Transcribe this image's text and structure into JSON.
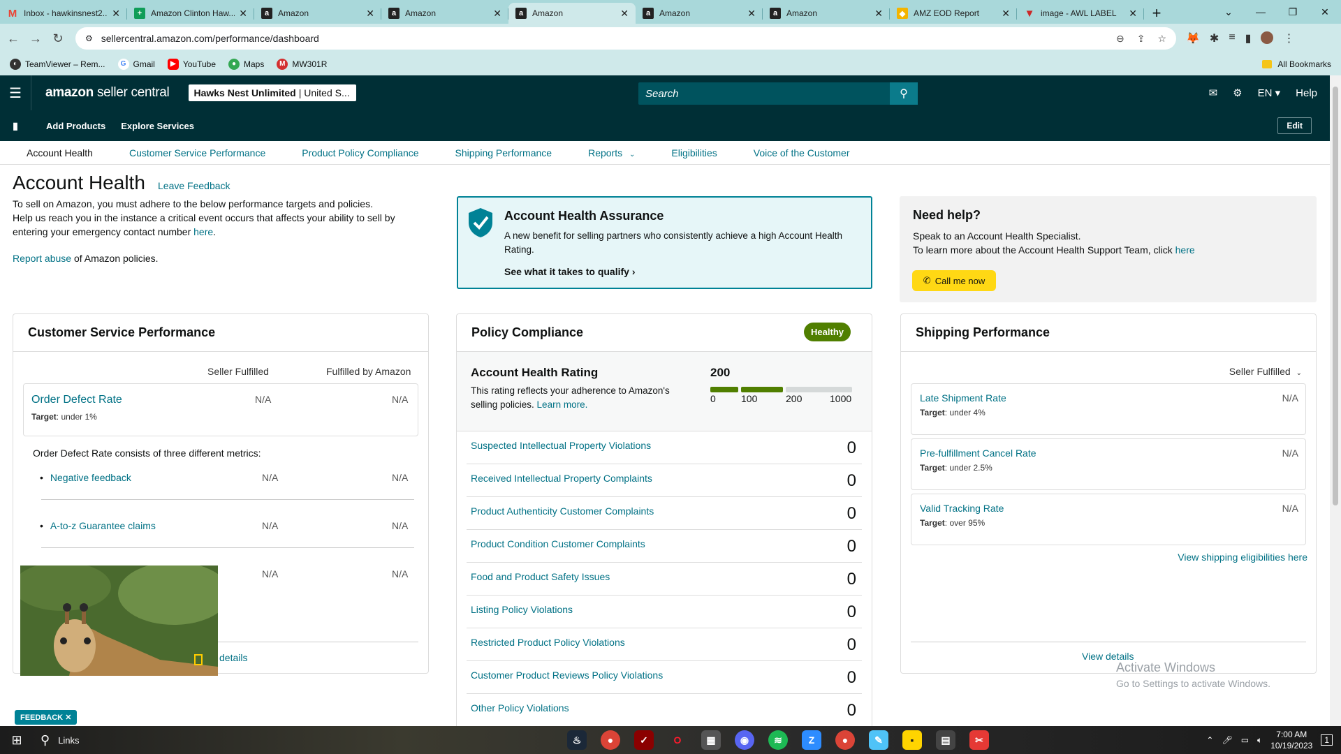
{
  "browser": {
    "tabs": [
      {
        "title": "Inbox - hawkinsnest2...",
        "icon": "gmail-icon",
        "color": "#ea4335"
      },
      {
        "title": "Amazon Clinton Haw...",
        "icon": "sheets-icon",
        "color": "#0f9d58"
      },
      {
        "title": "Amazon",
        "icon": "amazon-icon",
        "color": "#222"
      },
      {
        "title": "Amazon",
        "icon": "amazon-icon",
        "color": "#222"
      },
      {
        "title": "Amazon",
        "icon": "amazon-icon",
        "color": "#222",
        "active": true
      },
      {
        "title": "Amazon",
        "icon": "amazon-icon",
        "color": "#222"
      },
      {
        "title": "Amazon",
        "icon": "amazon-icon",
        "color": "#222"
      },
      {
        "title": "AMZ EOD Report",
        "icon": "report-icon",
        "color": "#f4b400"
      },
      {
        "title": "image - AWL LABEL",
        "icon": "vivaldi-icon",
        "color": "#cc2929"
      }
    ],
    "url": "sellercentral.amazon.com/performance/dashboard",
    "bookmarks": [
      "TeamViewer – Rem...",
      "Gmail",
      "YouTube",
      "Maps",
      "MW301R"
    ],
    "all_bookmarks": "All Bookmarks"
  },
  "header": {
    "logo_bold": "amazon",
    "logo_rest": "seller central",
    "store_name": "Hawks Nest Unlimited",
    "store_region": "| United S...",
    "search_placeholder": "Search",
    "lang": "EN",
    "help": "Help",
    "nav_links": [
      "Add Products",
      "Explore Services"
    ],
    "edit": "Edit"
  },
  "subnav": [
    "Account Health",
    "Customer Service Performance",
    "Product Policy Compliance",
    "Shipping Performance",
    "Reports",
    "Eligibilities",
    "Voice of the Customer"
  ],
  "page": {
    "title": "Account Health",
    "leave_feedback": "Leave Feedback",
    "intro_1": "To sell on Amazon, you must adhere to the below performance targets and policies.",
    "intro_2a": "Help us reach you in the instance a critical event occurs that affects your ability to sell by entering your emergency contact number ",
    "intro_2_link": "here",
    "intro_2b": ".",
    "report_link": "Report abuse",
    "report_rest": " of Amazon policies."
  },
  "assurance": {
    "title": "Account Health Assurance",
    "text": "A new benefit for selling partners who consistently achieve a high Account Health Rating.",
    "link": "See what it takes to qualify"
  },
  "help": {
    "title": "Need help?",
    "line1": "Speak to an Account Health Specialist.",
    "line2": "To learn more about the Account Health Support Team, click ",
    "line2_link": "here",
    "button": "Call me now"
  },
  "csp": {
    "title": "Customer Service Performance",
    "col1": "Seller Fulfilled",
    "col2": "Fulfilled by Amazon",
    "odr_label": "Order Defect Rate",
    "odr_target_bold": "Target",
    "odr_target": ": under 1%",
    "odr_sf": "N/A",
    "odr_fba": "N/A",
    "consists": "Order Defect Rate consists of three different metrics:",
    "metrics": [
      {
        "label": "Negative feedback",
        "sf": "N/A",
        "fba": "N/A"
      },
      {
        "label": "A-to-z Guarantee claims",
        "sf": "N/A",
        "fba": "N/A"
      },
      {
        "label": "",
        "sf": "N/A",
        "fba": "N/A"
      }
    ],
    "view_details": "details"
  },
  "policy": {
    "title": "Policy Compliance",
    "status": "Healthy",
    "ahr_title": "Account Health Rating",
    "ahr_text": "This rating reflects your adherence to Amazon's selling policies. ",
    "ahr_link": "Learn more.",
    "score": "200",
    "scale": [
      "0",
      "100",
      "200",
      "1000"
    ],
    "rows": [
      {
        "label": "Suspected Intellectual Property Violations",
        "value": "0"
      },
      {
        "label": "Received Intellectual Property Complaints",
        "value": "0"
      },
      {
        "label": "Product Authenticity Customer Complaints",
        "value": "0"
      },
      {
        "label": "Product Condition Customer Complaints",
        "value": "0"
      },
      {
        "label": "Food and Product Safety Issues",
        "value": "0"
      },
      {
        "label": "Listing Policy Violations",
        "value": "0"
      },
      {
        "label": "Restricted Product Policy Violations",
        "value": "0"
      },
      {
        "label": "Customer Product Reviews Policy Violations",
        "value": "0"
      },
      {
        "label": "Other Policy Violations",
        "value": "0"
      }
    ]
  },
  "shipping": {
    "title": "Shipping Performance",
    "filter": "Seller Fulfilled",
    "metrics": [
      {
        "label": "Late Shipment Rate",
        "target_bold": "Target",
        "target": ": under 4%",
        "value": "N/A"
      },
      {
        "label": "Pre-fulfillment Cancel Rate",
        "target_bold": "Target",
        "target": ": under 2.5%",
        "value": "N/A"
      },
      {
        "label": "Valid Tracking Rate",
        "target_bold": "Target",
        "target": ": over 95%",
        "value": "N/A"
      }
    ],
    "eligibilities_link": "View shipping eligibilities here",
    "view_details": "View details"
  },
  "feedback": "FEEDBACK",
  "activate": {
    "line1": "Activate Windows",
    "line2": "Go to Settings to activate Windows."
  },
  "taskbar": {
    "search": "Links",
    "time": "7:00 AM",
    "date": "10/19/2023",
    "notif": "1"
  }
}
